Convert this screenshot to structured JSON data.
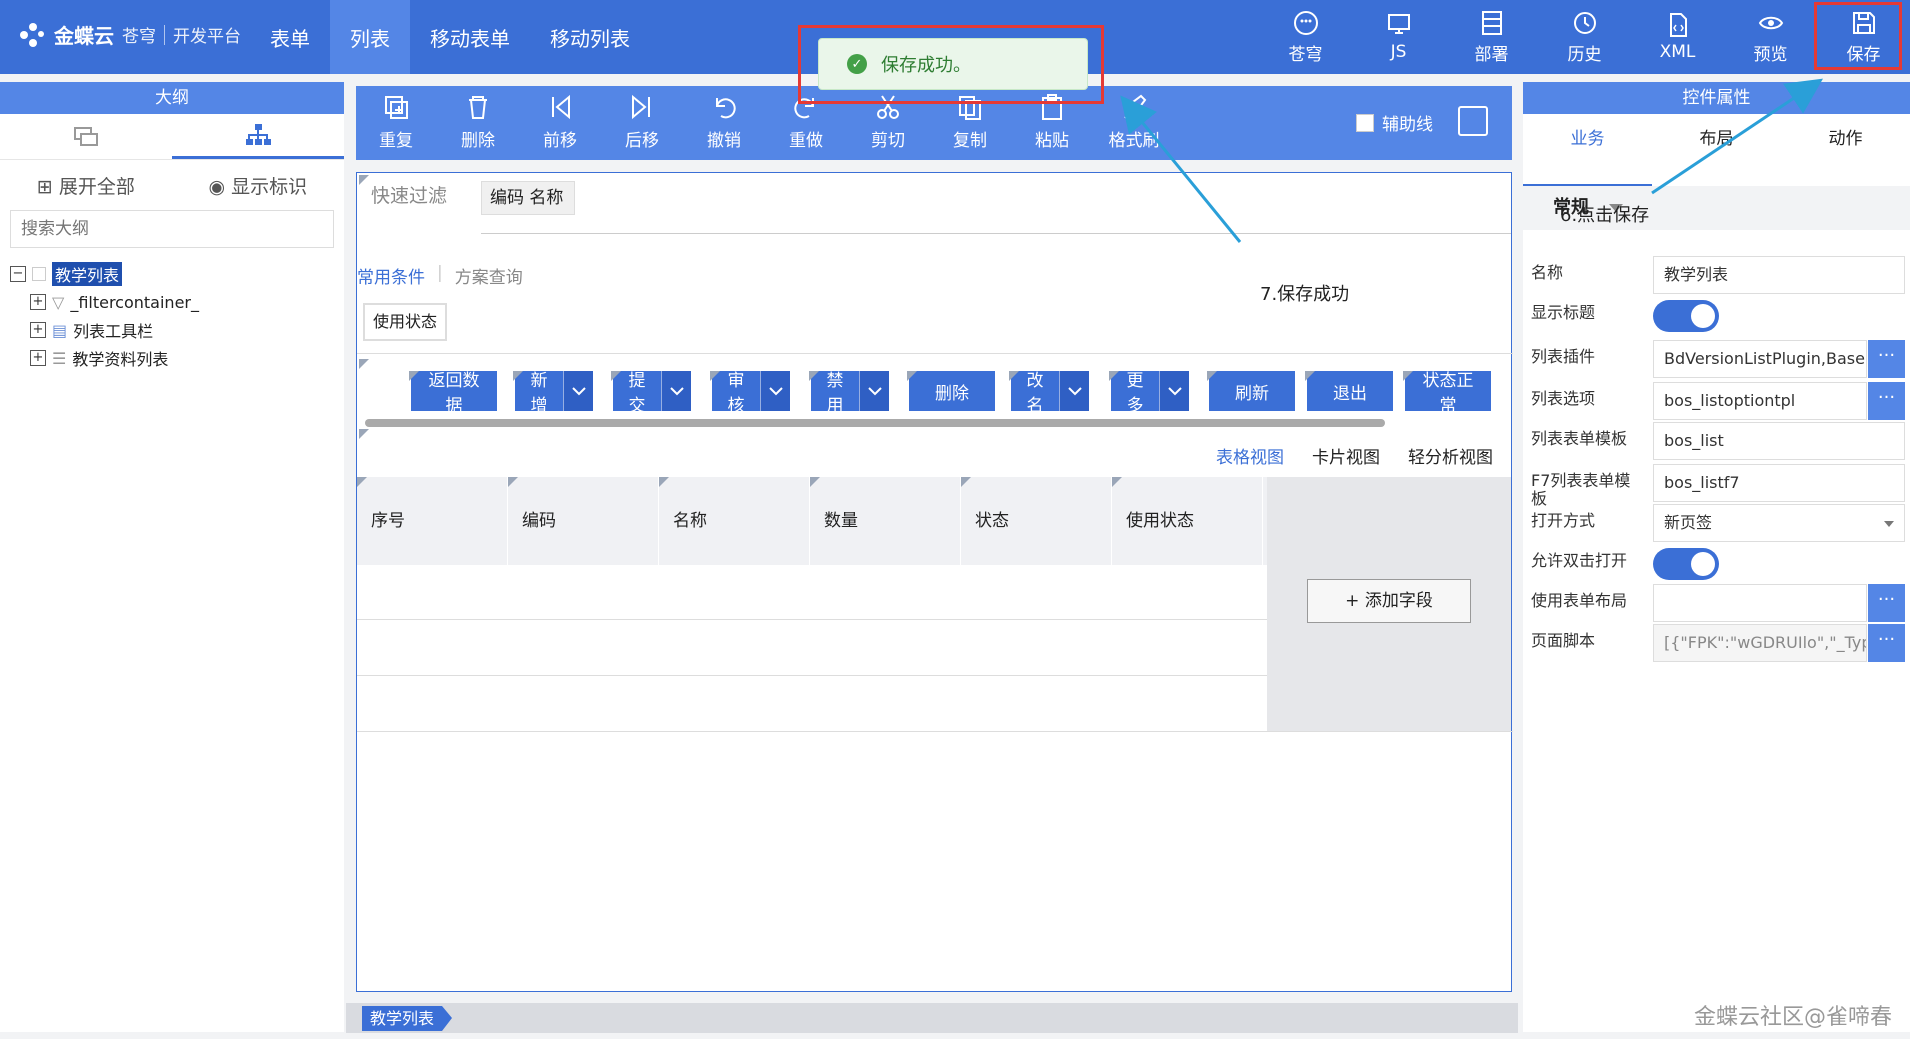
{
  "app": {
    "brand": "金蝶云",
    "brand_sub": "苍穹",
    "platform": "开发平台"
  },
  "nav": [
    "表单",
    "列表",
    "移动表单",
    "移动列表"
  ],
  "nav_active": 1,
  "top_tools": [
    "苍穹",
    "JS",
    "部署",
    "历史",
    "XML",
    "预览",
    "保存"
  ],
  "toast": {
    "message": "保存成功。"
  },
  "outline": {
    "title": "大纲",
    "expand_all": "展开全部",
    "show_ids": "显示标识",
    "search_placeholder": "搜索大纲",
    "root": "教学列表",
    "children": [
      "_filtercontainer_",
      "列表工具栏",
      "教学资料列表"
    ]
  },
  "canvas_toolbar": {
    "items": [
      "重复",
      "删除",
      "前移",
      "后移",
      "撤销",
      "重做",
      "剪切",
      "复制",
      "粘贴",
      "格式刷"
    ],
    "aux_line": "辅助线"
  },
  "filter": {
    "quick_filter": "快速过滤",
    "quick_field": "编码  名称",
    "common_conditions": "常用条件",
    "scheme_query": "方案查询",
    "chip": "使用状态"
  },
  "list_buttons": [
    {
      "label": "返回数据",
      "dropdown": false
    },
    {
      "label": "新增",
      "dropdown": true
    },
    {
      "label": "提交",
      "dropdown": true
    },
    {
      "label": "审核",
      "dropdown": true
    },
    {
      "label": "禁用",
      "dropdown": true
    },
    {
      "label": "删除",
      "dropdown": false
    },
    {
      "label": "改名",
      "dropdown": true
    },
    {
      "label": "更多",
      "dropdown": true
    },
    {
      "label": "刷新",
      "dropdown": false
    },
    {
      "label": "退出",
      "dropdown": false
    },
    {
      "label": "状态正常",
      "dropdown": false
    }
  ],
  "views": [
    "表格视图",
    "卡片视图",
    "轻分析视图"
  ],
  "grid_columns": [
    "序号",
    "编码",
    "名称",
    "数量",
    "状态",
    "使用状态"
  ],
  "add_field": "+ 添加字段",
  "bottom_tab": "教学列表",
  "props": {
    "title": "控件属性",
    "tabs": [
      "业务",
      "布局",
      "动作"
    ],
    "group": "常规",
    "rows": [
      {
        "label": "名称",
        "value": "教学列表",
        "kind": "text"
      },
      {
        "label": "显示标题",
        "value": "",
        "kind": "switch"
      },
      {
        "label": "列表插件",
        "value": "BdVersionListPlugin,BaseL",
        "kind": "button"
      },
      {
        "label": "列表选项",
        "value": "bos_listoptiontpl",
        "kind": "button"
      },
      {
        "label": "列表表单模板",
        "value": "bos_list",
        "kind": "text"
      },
      {
        "label": "F7列表表单模板",
        "value": "bos_listf7",
        "kind": "text"
      },
      {
        "label": "打开方式",
        "value": "新页签",
        "kind": "select"
      },
      {
        "label": "允许双击打开",
        "value": "",
        "kind": "switch"
      },
      {
        "label": "使用表单布局",
        "value": "",
        "kind": "button"
      },
      {
        "label": "页面脚本",
        "value": "[{\"FPK\":\"wGDRUIlo\",\"_Type_",
        "kind": "button-disabled"
      }
    ]
  },
  "annotations": {
    "step6": "6.点击保存",
    "step7": "7.保存成功"
  },
  "credit": "金蝶云社区@雀啼春",
  "colors": {
    "primary": "#3b6fd6",
    "toolbar": "#5486e6",
    "highlight": "#e53935",
    "success": "#43a047"
  }
}
